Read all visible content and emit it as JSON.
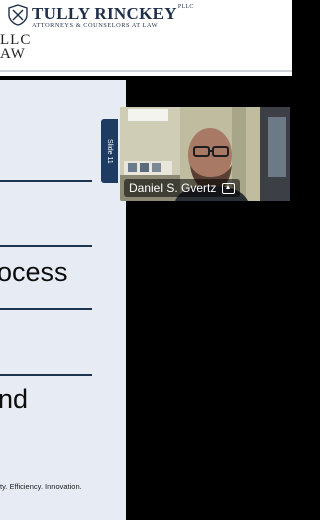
{
  "brand": {
    "name": "TULLY RINCKEY",
    "suffix": "PLLC",
    "tagline": "ATTORNEYS & COUNSELORS AT LAW",
    "cropped_line1": "LLC",
    "cropped_line2": "AW"
  },
  "slide": {
    "tab_label": "Slide 11",
    "text_1": "ocess",
    "text_2": "nd",
    "footer": "ty. Efficiency. Innovation."
  },
  "participant": {
    "name": "Daniel S. Gvertz",
    "pin_icon": "pin-icon"
  },
  "colors": {
    "brand_navy": "#1f2f4a",
    "slide_bg": "#e7ebf3",
    "tab_bg": "#1e3c62"
  }
}
